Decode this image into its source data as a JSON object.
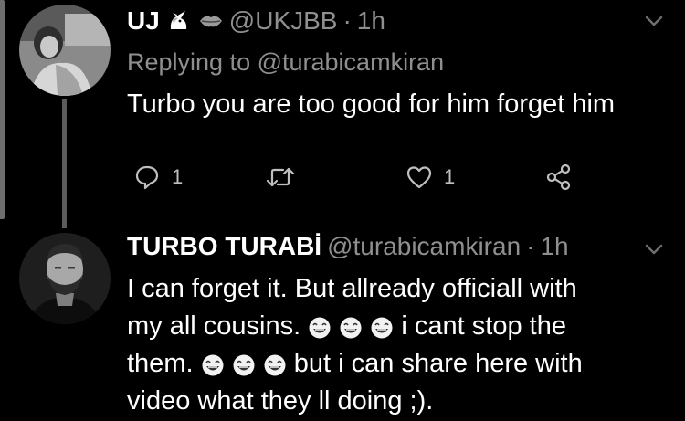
{
  "tweets": [
    {
      "display_name": "UJ",
      "badges": [
        "unicorn-emoji",
        "lips-emoji"
      ],
      "handle": "@UKJBB",
      "separator": "·",
      "time": "1h",
      "reply_prefix": "Replying to",
      "reply_mention": "@turabicamkiran",
      "body": "Turbo you are too good for him forget him",
      "actions": {
        "reply_count": "1",
        "retweet_count": "",
        "like_count": "1"
      }
    },
    {
      "display_name": "TURBO TURABİ",
      "handle": "@turabicamkiran",
      "separator": "·",
      "time": "1h",
      "body_lines": [
        {
          "text": "I can forget it. But allready officiall with"
        },
        {
          "pre": "my all cousins.",
          "emoji": [
            "face-with-tears-of-joy-emoji",
            "face-with-tears-of-joy-emoji",
            "face-with-tears-of-joy-emoji"
          ],
          "post": "i cant stop the"
        },
        {
          "pre": "them.",
          "emoji": [
            "face-with-tears-of-joy-emoji",
            "face-with-tears-of-joy-emoji",
            "face-with-tears-of-joy-emoji"
          ],
          "post": "but i can share here with"
        },
        {
          "text": "video what they ll doing ;)."
        }
      ]
    }
  ],
  "colors": {
    "background": "#000000",
    "primary_text": "#ffffff",
    "secondary_text": "#8f8f8f",
    "icon": "#bfbfbf",
    "thread_line": "#5c5c5c"
  }
}
